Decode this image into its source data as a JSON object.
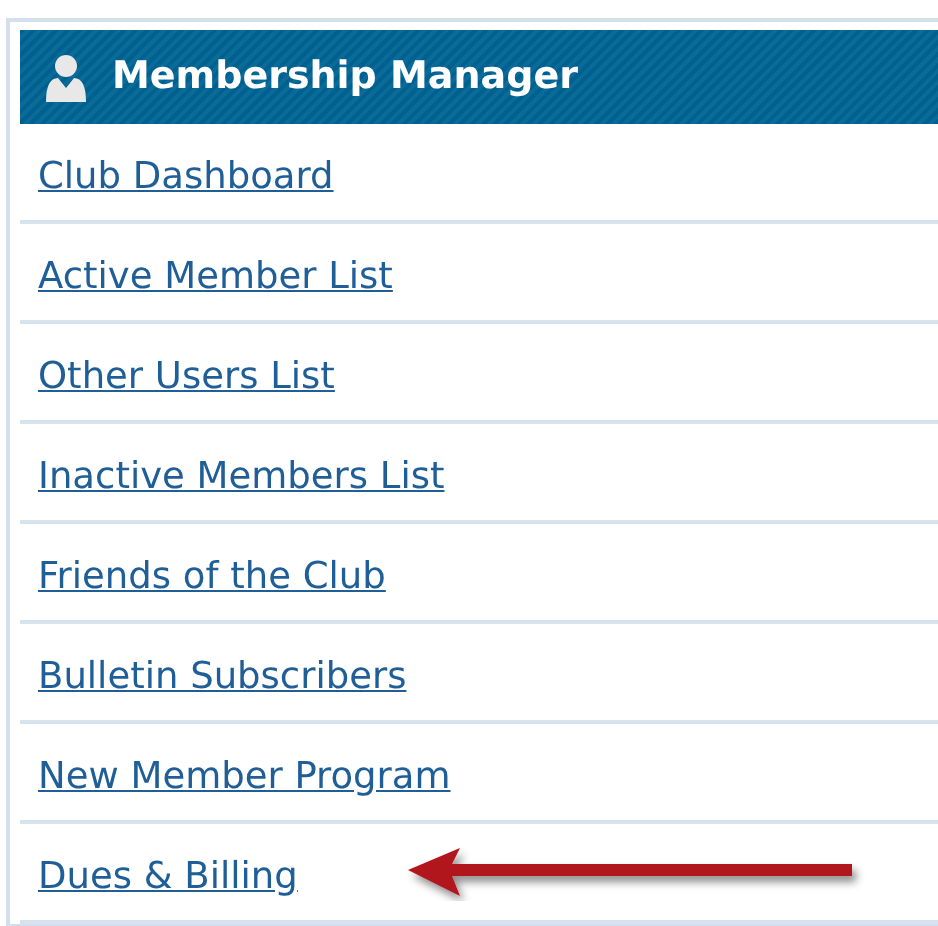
{
  "panel": {
    "title": "Membership Manager",
    "links": [
      "Club Dashboard",
      "Active Member List",
      "Other Users List",
      "Inactive Members List",
      "Friends of the Club",
      "Bulletin Subscribers",
      "New Member Program",
      "Dues & Billing"
    ]
  }
}
